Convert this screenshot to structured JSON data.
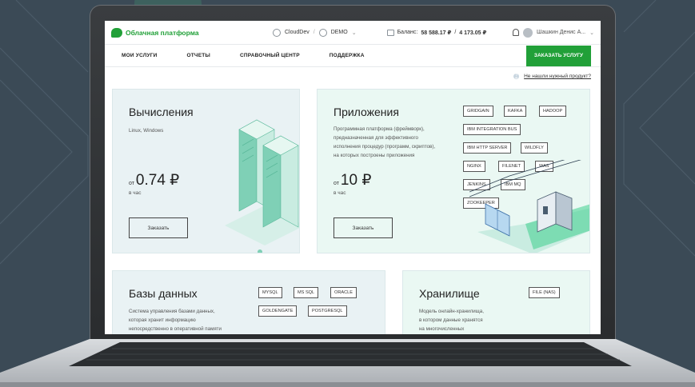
{
  "header": {
    "logo_text": "Облачная платформа",
    "project": "CloudDev",
    "separator": "/",
    "env": "DEMO",
    "balance_label": "Баланс:",
    "balance_value": "58 588.17 ₽",
    "balance_sep": "/",
    "balance_second": "4 173.05 ₽",
    "user_name": "Шашкин Денис А..."
  },
  "nav": {
    "items": [
      "МОИ УСЛУГИ",
      "ОТЧЕТЫ",
      "СПРАВОЧНЫЙ ЦЕНТР",
      "ПОДДЕРЖКА"
    ],
    "order_button": "ЗАКАЗАТЬ УСЛУГУ"
  },
  "help_link": "Не нашли нужный продукт?",
  "cards": {
    "compute": {
      "title": "Вычисления",
      "subtitle": "Linux, Windows",
      "from": "от",
      "price": "0.74 ₽",
      "per": "в час",
      "button": "Заказать"
    },
    "apps": {
      "title": "Приложения",
      "description": [
        "Программная платформа (фреймворк),",
        "предназначенная для эффективного",
        "исполнения процедур (программ, скриптов),",
        "на которых построены приложения"
      ],
      "from": "от",
      "price": "10 ₽",
      "per": "в час",
      "button": "Заказать",
      "tags": [
        "GRIDGAIN",
        "KAFKA",
        "HADOOP",
        "IBM INTEGRATION BUS",
        "IBM HTTP SERVER",
        "WILDFLY",
        "NGINX",
        "FILENET",
        "WAS",
        "JENKINS",
        "IBM MQ",
        "ZOOKEEPER"
      ]
    },
    "db": {
      "title": "Базы данных",
      "description": [
        "Система управления базами данных,",
        "которая хранит информацию",
        "непосредственно в оперативной памяти"
      ],
      "tags": [
        "MYSQL",
        "MS SQL",
        "ORACLE",
        "GOLDENGATE",
        "POSTGRESQL"
      ]
    },
    "storage": {
      "title": "Хранилище",
      "description": [
        "Модель онлайн-хранилища,",
        "в котором данные хранятся",
        "на многочисленных"
      ],
      "tags": [
        "FILE (NAS)"
      ]
    }
  },
  "colors": {
    "accent": "#21a038",
    "background": "#3b4a56"
  }
}
